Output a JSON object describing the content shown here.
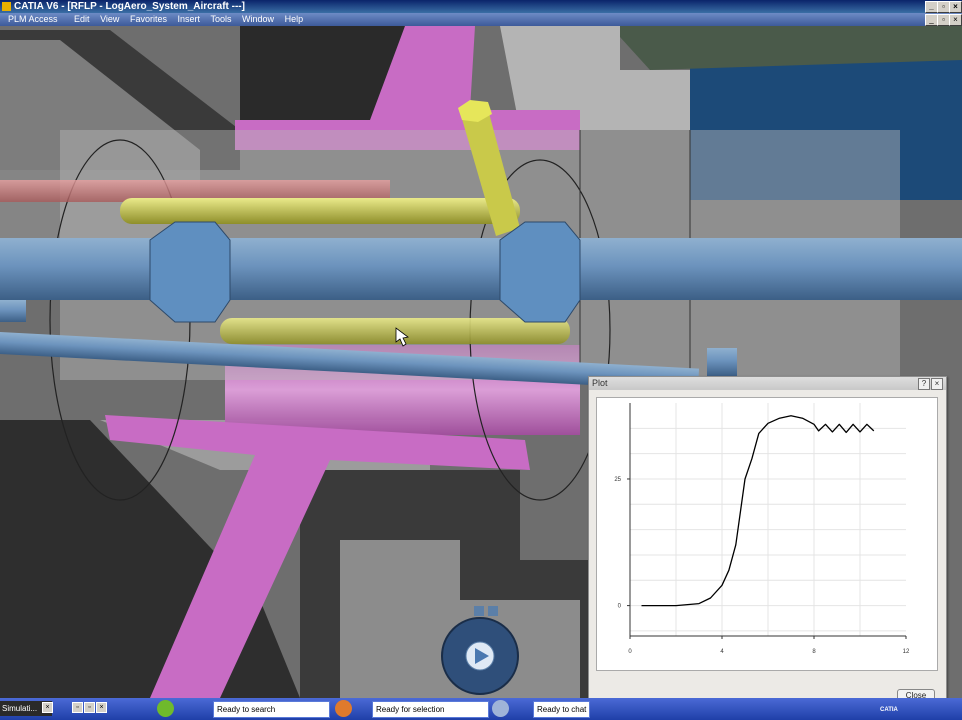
{
  "window": {
    "title": "CATIA V6 - [RFLP - LogAero_System_Aircraft ---]",
    "controls": [
      "_",
      "▫",
      "×"
    ]
  },
  "menu": {
    "items": [
      "PLM Access",
      "Edit",
      "View",
      "Favorites",
      "Insert",
      "Tools",
      "Window",
      "Help"
    ],
    "controls": [
      "_",
      "▫",
      "×"
    ]
  },
  "plot_dialog": {
    "title": "Plot",
    "help_label": "?",
    "close_x": "×",
    "close_button": "Close"
  },
  "chart_data": {
    "type": "line",
    "title": "",
    "xlabel": "",
    "ylabel": "",
    "xlim": [
      0,
      12
    ],
    "ylim": [
      -6,
      40
    ],
    "x_ticks": [
      0,
      4,
      8,
      12
    ],
    "y_ticks": [
      0,
      25
    ],
    "grid": true,
    "series": [
      {
        "x": [
          0.5,
          2.0,
          3.0,
          3.5,
          4.0,
          4.3,
          4.6,
          5.0,
          5.3,
          5.6,
          6.0,
          6.5,
          7.0,
          7.5,
          8.0,
          8.2,
          8.5,
          8.8,
          9.1,
          9.4,
          9.7,
          10.0,
          10.3,
          10.6
        ],
        "y": [
          0,
          0,
          0.4,
          1.5,
          4,
          7,
          12,
          25,
          29,
          34,
          36,
          37,
          37.5,
          37,
          35.8,
          34.5,
          35.8,
          34.3,
          35.8,
          34.2,
          35.8,
          34.3,
          35.8,
          34.5
        ]
      }
    ]
  },
  "taskbar": {
    "start_label": "Simulati...",
    "status_search": "Ready to search",
    "status_selection": "Ready for selection",
    "status_chat": "Ready to chat",
    "brand": "CATIA"
  }
}
